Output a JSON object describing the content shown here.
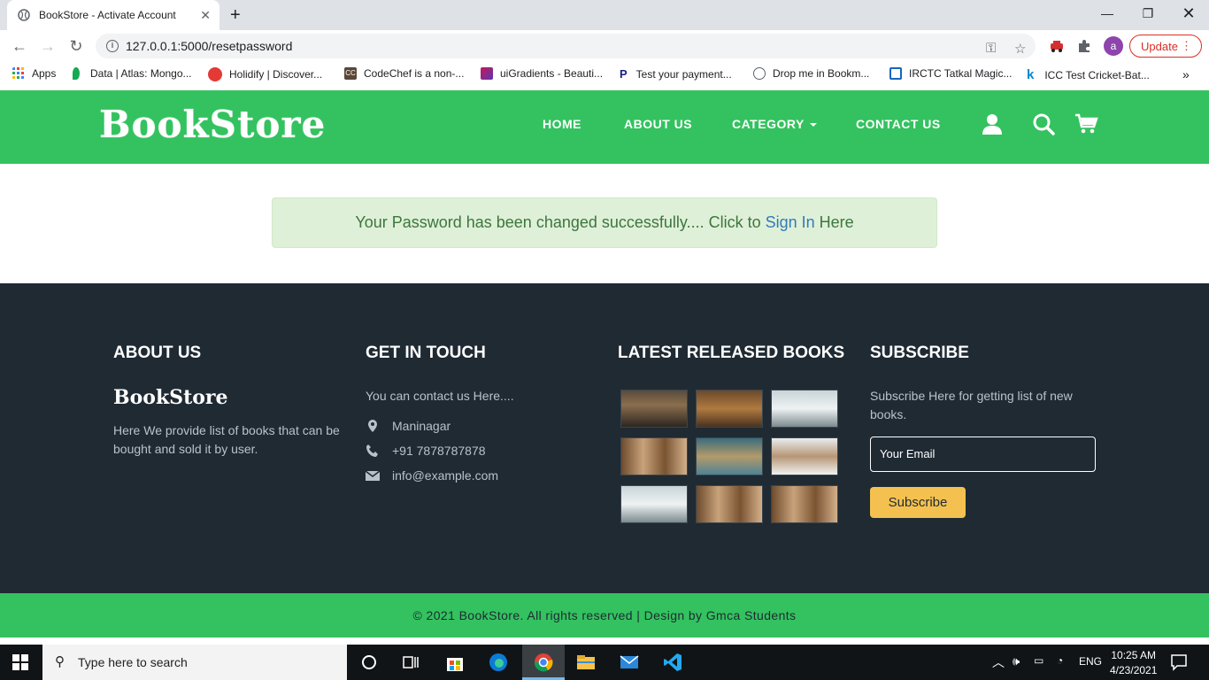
{
  "browser": {
    "tab_title": "BookStore - Activate Account",
    "url": "127.0.0.1:5000/resetpassword",
    "profile_initial": "a",
    "update_label": "Update",
    "bookmarks": [
      {
        "label": "Apps",
        "color": "#4285f4"
      },
      {
        "label": "Data | Atlas: Mongo...",
        "color": "#13aa52"
      },
      {
        "label": "Holidify | Discover...",
        "color": "#e53935"
      },
      {
        "label": "CodeChef is a non-...",
        "color": "#5b4636"
      },
      {
        "label": "uiGradients - Beauti...",
        "color": "#8e44ad"
      },
      {
        "label": "Test your payment...",
        "color": "#1a237e"
      },
      {
        "label": "Drop me in Bookm...",
        "color": "#5f6368"
      },
      {
        "label": "IRCTC Tatkal Magic...",
        "color": "#1565c0"
      },
      {
        "label": "ICC Test Cricket-Bat...",
        "color": "#0288d1"
      }
    ]
  },
  "header": {
    "logo": "BookStore",
    "nav": [
      {
        "label": "HOME"
      },
      {
        "label": "ABOUT US"
      },
      {
        "label": "CATEGORY"
      },
      {
        "label": "CONTACT US"
      }
    ]
  },
  "alert": {
    "prefix": "Your Password has been changed successfully.... Click to",
    "link": "Sign In",
    "suffix": "Here"
  },
  "footer": {
    "about": {
      "heading": "ABOUT US",
      "logo": "BookStore",
      "text": "Here We provide list of books that can be bought and sold it by user."
    },
    "contact": {
      "heading": "GET IN TOUCH",
      "intro": "You can contact us Here....",
      "address": "Maninagar",
      "phone": "+91 7878787878",
      "email": "info@example.com"
    },
    "latest": {
      "heading": "LATEST RELEASED BOOKS"
    },
    "subscribe": {
      "heading": "SUBSCRIBE",
      "text": "Subscribe Here for getting list of new books.",
      "placeholder": "Your Email",
      "button": "Subscribe"
    },
    "copyright": "© 2021 BookStore. All rights reserved | Design by Gmca Students"
  },
  "taskbar": {
    "search_placeholder": "Type here to search",
    "lang": "ENG",
    "time": "10:25 AM",
    "date": "4/23/2021"
  }
}
